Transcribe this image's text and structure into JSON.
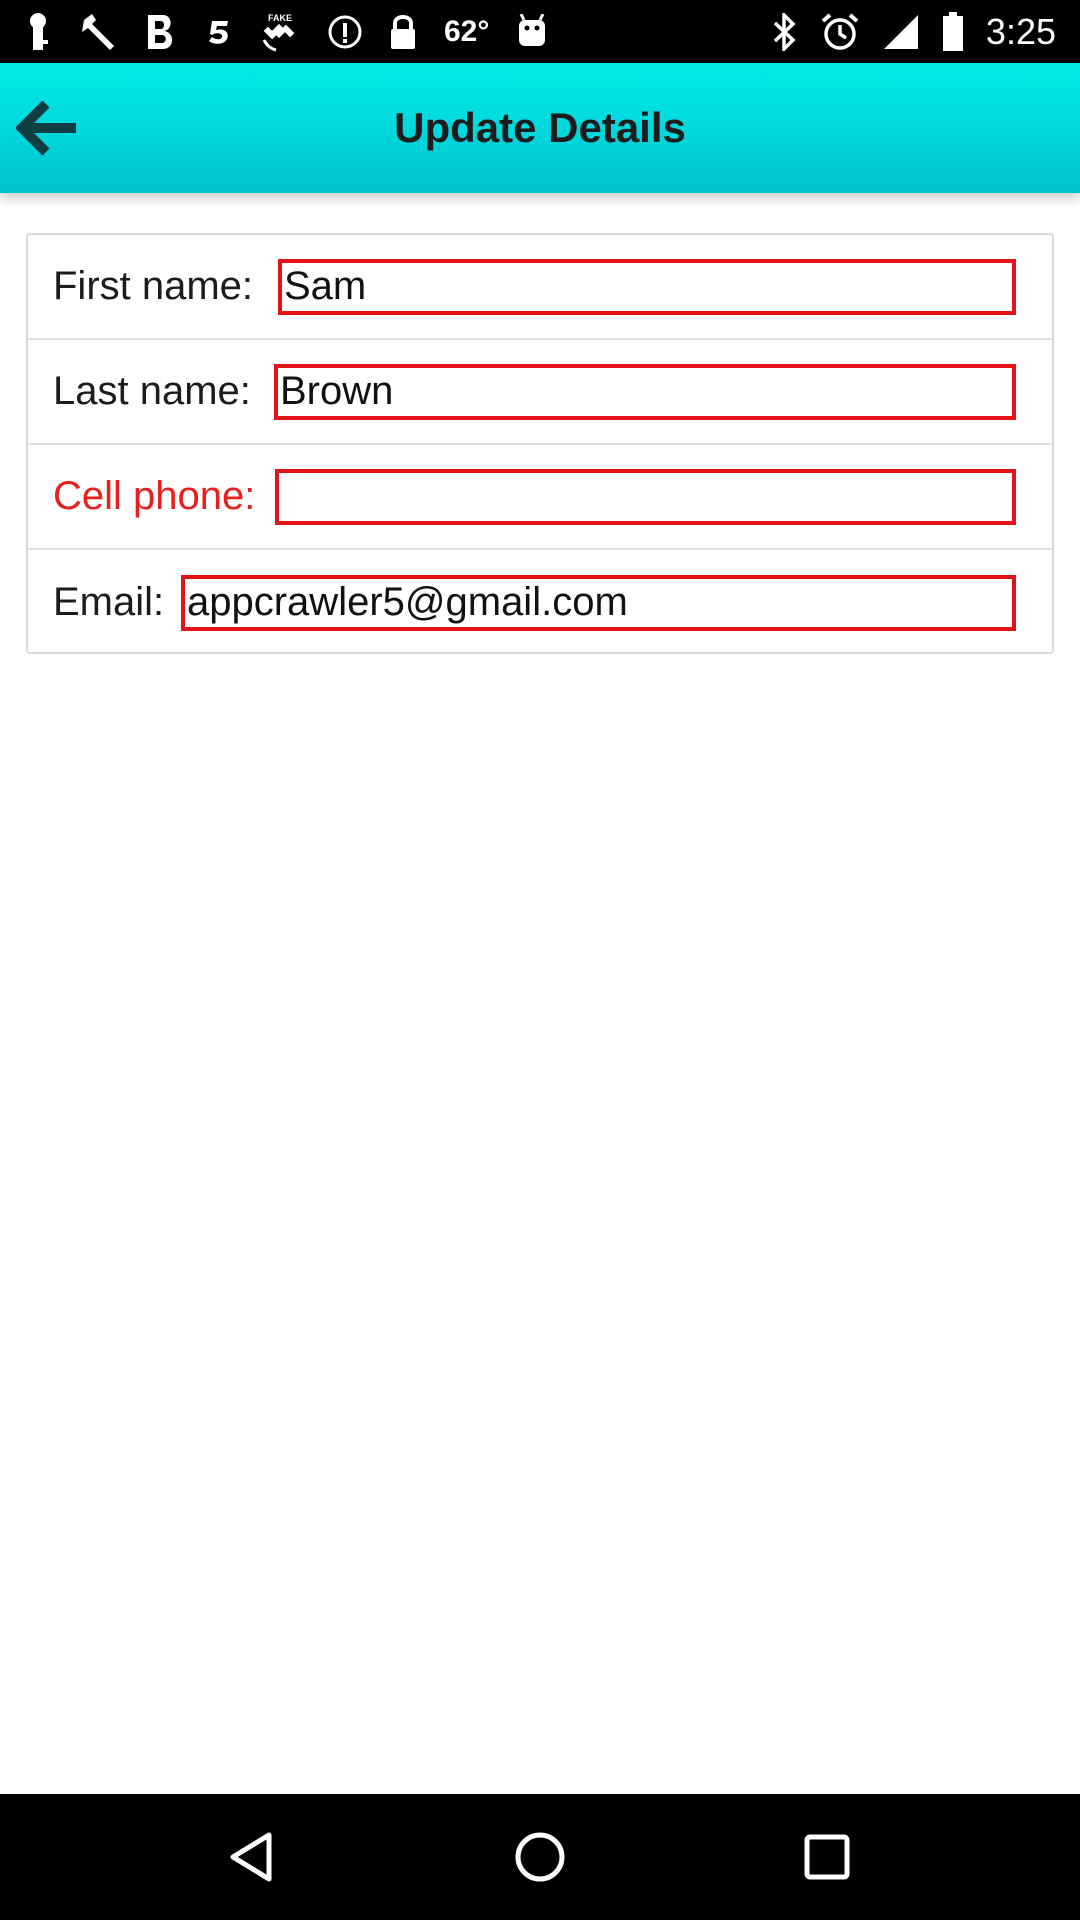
{
  "status_bar": {
    "battery_temp": "62°",
    "time": "3:25",
    "icons": [
      "key-icon",
      "wrench-icon",
      "bold-b-icon",
      "five-icon",
      "fake-gps-satellite-icon",
      "info-icon",
      "lock-icon",
      "android-icon",
      "bluetooth-icon",
      "alarm-icon",
      "signal-icon",
      "battery-icon"
    ]
  },
  "app_bar": {
    "title": "Update Details",
    "back_icon": "back-arrow-icon"
  },
  "form": {
    "first_name": {
      "label": "First name:",
      "value": "Sam"
    },
    "last_name": {
      "label": "Last name:",
      "value": "Brown"
    },
    "cell_phone": {
      "label": "Cell phone:",
      "value": "",
      "required": true
    },
    "email": {
      "label": "Email:",
      "value": "appcrawler5@gmail.com"
    }
  },
  "nav_bar": {
    "back": "nav-back-icon",
    "home": "nav-home-icon",
    "recents": "nav-recents-icon"
  },
  "colors": {
    "app_bar": "#00d6dc",
    "input_border": "#e2141a",
    "required_label": "#e8201d"
  }
}
